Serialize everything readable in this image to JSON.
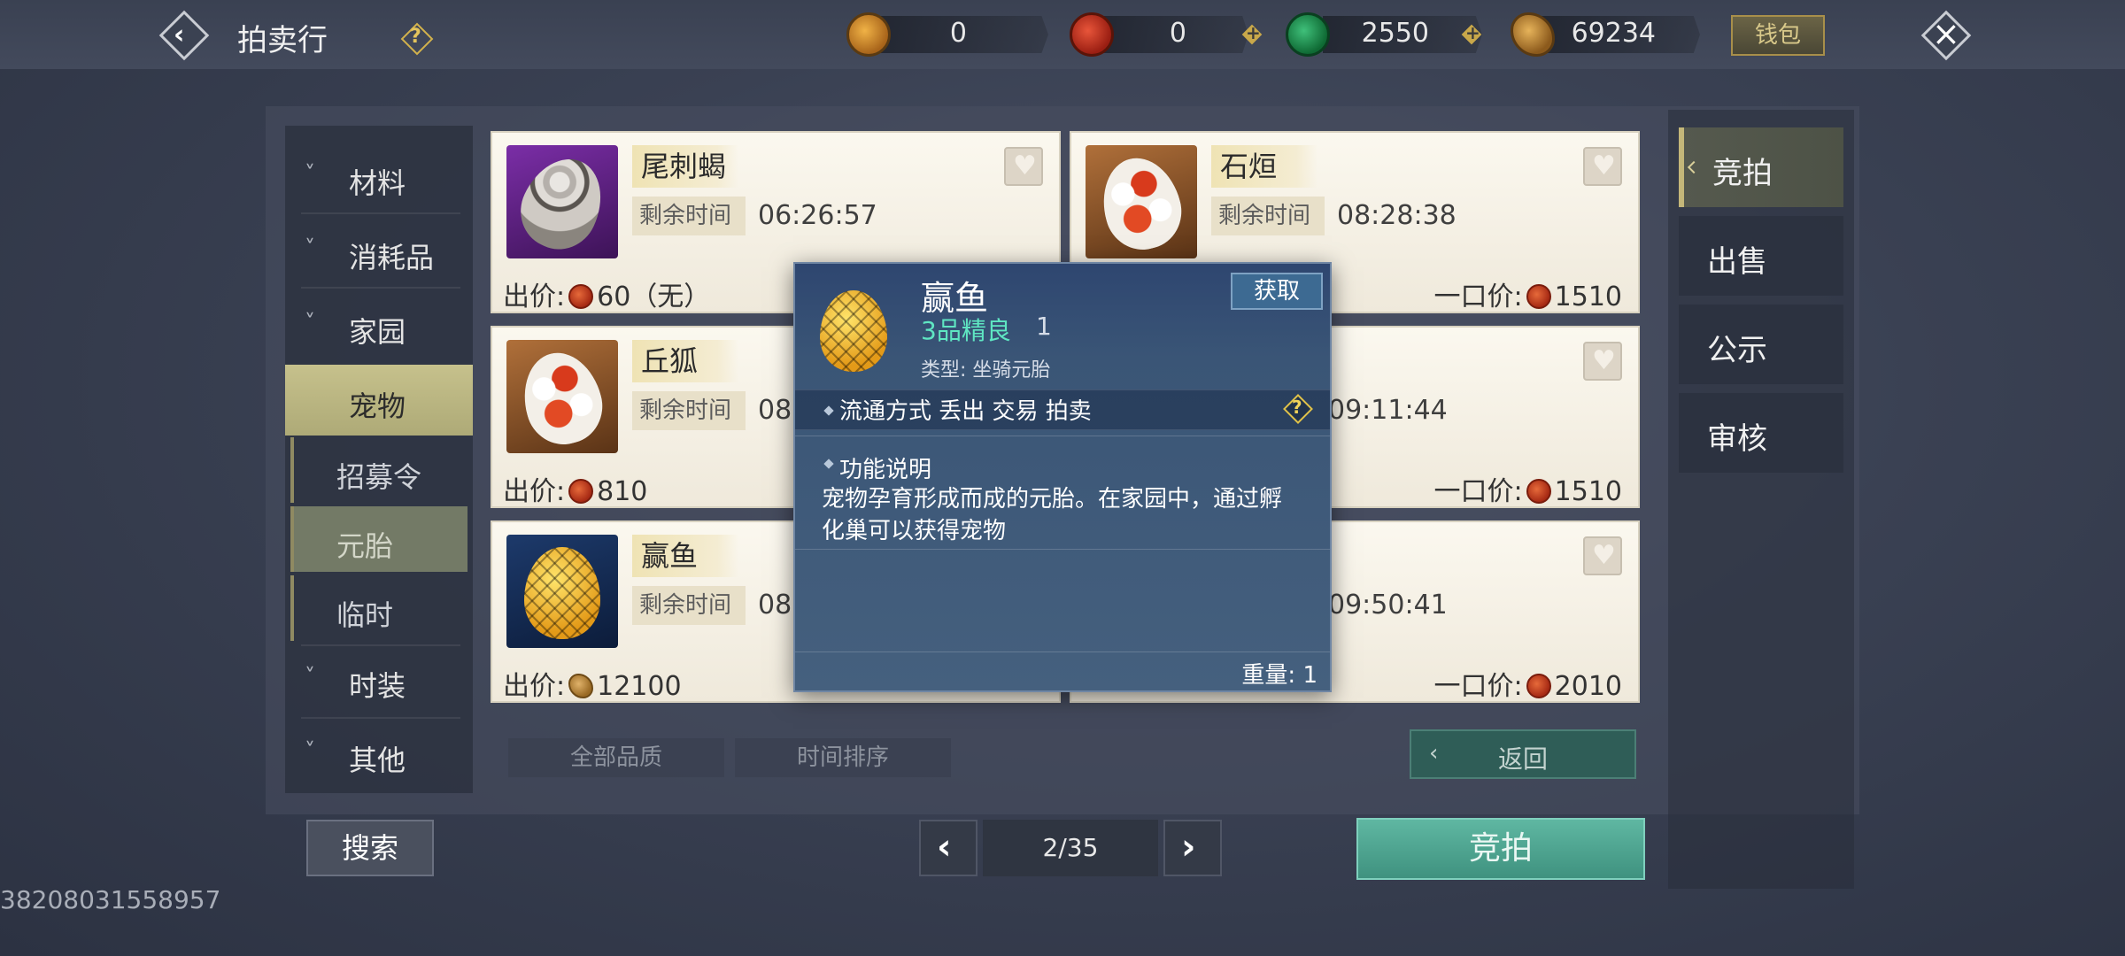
{
  "header": {
    "title": "拍卖行",
    "wallet_label": "钱包"
  },
  "currencies": [
    {
      "icon": "gold-pouch-icon",
      "value": "0"
    },
    {
      "icon": "red-spiral-coin-icon",
      "value": "0"
    },
    {
      "icon": "jade-coin-icon",
      "value": "2550"
    },
    {
      "icon": "gold-leaf-coin-icon",
      "value": "69234"
    }
  ],
  "left_nav": {
    "items": [
      {
        "label": "材料"
      },
      {
        "label": "消耗品"
      },
      {
        "label": "家园"
      },
      {
        "label": "宠物"
      },
      {
        "label": "时装"
      },
      {
        "label": "其他"
      }
    ],
    "sub_items": [
      {
        "label": "招募令"
      },
      {
        "label": "元胎"
      },
      {
        "label": "临时"
      }
    ]
  },
  "listings": [
    {
      "name": "尾刺蝎",
      "time_label": "剩余时间",
      "time": "06:26:57",
      "bid_label": "出价:",
      "bid": "60（无）",
      "buyout_label": "",
      "buyout": ""
    },
    {
      "name": "石烜",
      "time_label": "剩余时间",
      "time": "08:28:38",
      "bid_label": "",
      "bid": "",
      "buyout_label": "一口价:",
      "buyout": "1510"
    },
    {
      "name": "丘狐",
      "time_label": "剩余时间",
      "time": "08:",
      "bid_label": "出价:",
      "bid": "810",
      "buyout_label": "",
      "buyout": ""
    },
    {
      "name": "",
      "time_label": "",
      "time": "09:11:44",
      "bid_label": "",
      "bid": "",
      "buyout_label": "一口价:",
      "buyout": "1510"
    },
    {
      "name": "赢鱼",
      "time_label": "剩余时间",
      "time": "08:",
      "bid_label": "出价:",
      "bid": "12100",
      "buyout_label": "",
      "buyout": ""
    },
    {
      "name": "",
      "time_label": "",
      "time": "09:50:41",
      "bid_label": "",
      "bid": "",
      "buyout_label": "一口价:",
      "buyout": "2010"
    }
  ],
  "popup": {
    "name": "赢鱼",
    "quality": "3品精良",
    "count": "1",
    "type": "类型: 坐骑元胎",
    "get_label": "获取",
    "circulation": "流通方式   丢出 交易 拍卖",
    "function_title": "功能说明",
    "function_body": "宠物孕育形成而成的元胎。在家园中，通过孵化巢可以获得宠物",
    "weight": "重量: 1"
  },
  "filters": {
    "quality": "全部品质",
    "sort": "时间排序",
    "return_label": "返回"
  },
  "bottom": {
    "search_label": "搜索",
    "page": "2/35",
    "bid_label": "竞拍"
  },
  "right_tabs": [
    {
      "label": "竞拍"
    },
    {
      "label": "出售"
    },
    {
      "label": "公示"
    },
    {
      "label": "审核"
    }
  ],
  "footer_id": "38208031558957",
  "colors": {
    "quality_green": "#5fe6c2",
    "accent_gold": "#c4b779",
    "bid_button": "#4fa590"
  }
}
